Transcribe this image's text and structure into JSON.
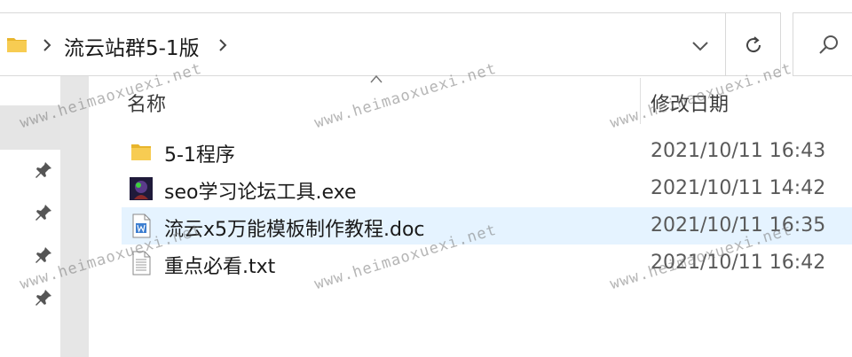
{
  "address": {
    "path": "流云站群5-1版"
  },
  "columns": {
    "name": "名称",
    "date_modified": "修改日期"
  },
  "files": [
    {
      "name": "5-1程序",
      "date": "2021/10/11 16:43",
      "icon": "folder-icon"
    },
    {
      "name": "seo学习论坛工具.exe",
      "date": "2021/10/11 14:42",
      "icon": "exe-app-icon"
    },
    {
      "name": "流云x5万能模板制作教程.doc",
      "date": "2021/10/11 16:35",
      "icon": "word-doc-icon"
    },
    {
      "name": "重点必看.txt",
      "date": "2021/10/11 16:42",
      "icon": "text-file-icon"
    }
  ],
  "watermark": "www.heimaoxuexi.net",
  "colors": {
    "selected_row": "#e5f3ff",
    "folder": "#f5c542",
    "nav_selected": "#e5e5e5"
  }
}
